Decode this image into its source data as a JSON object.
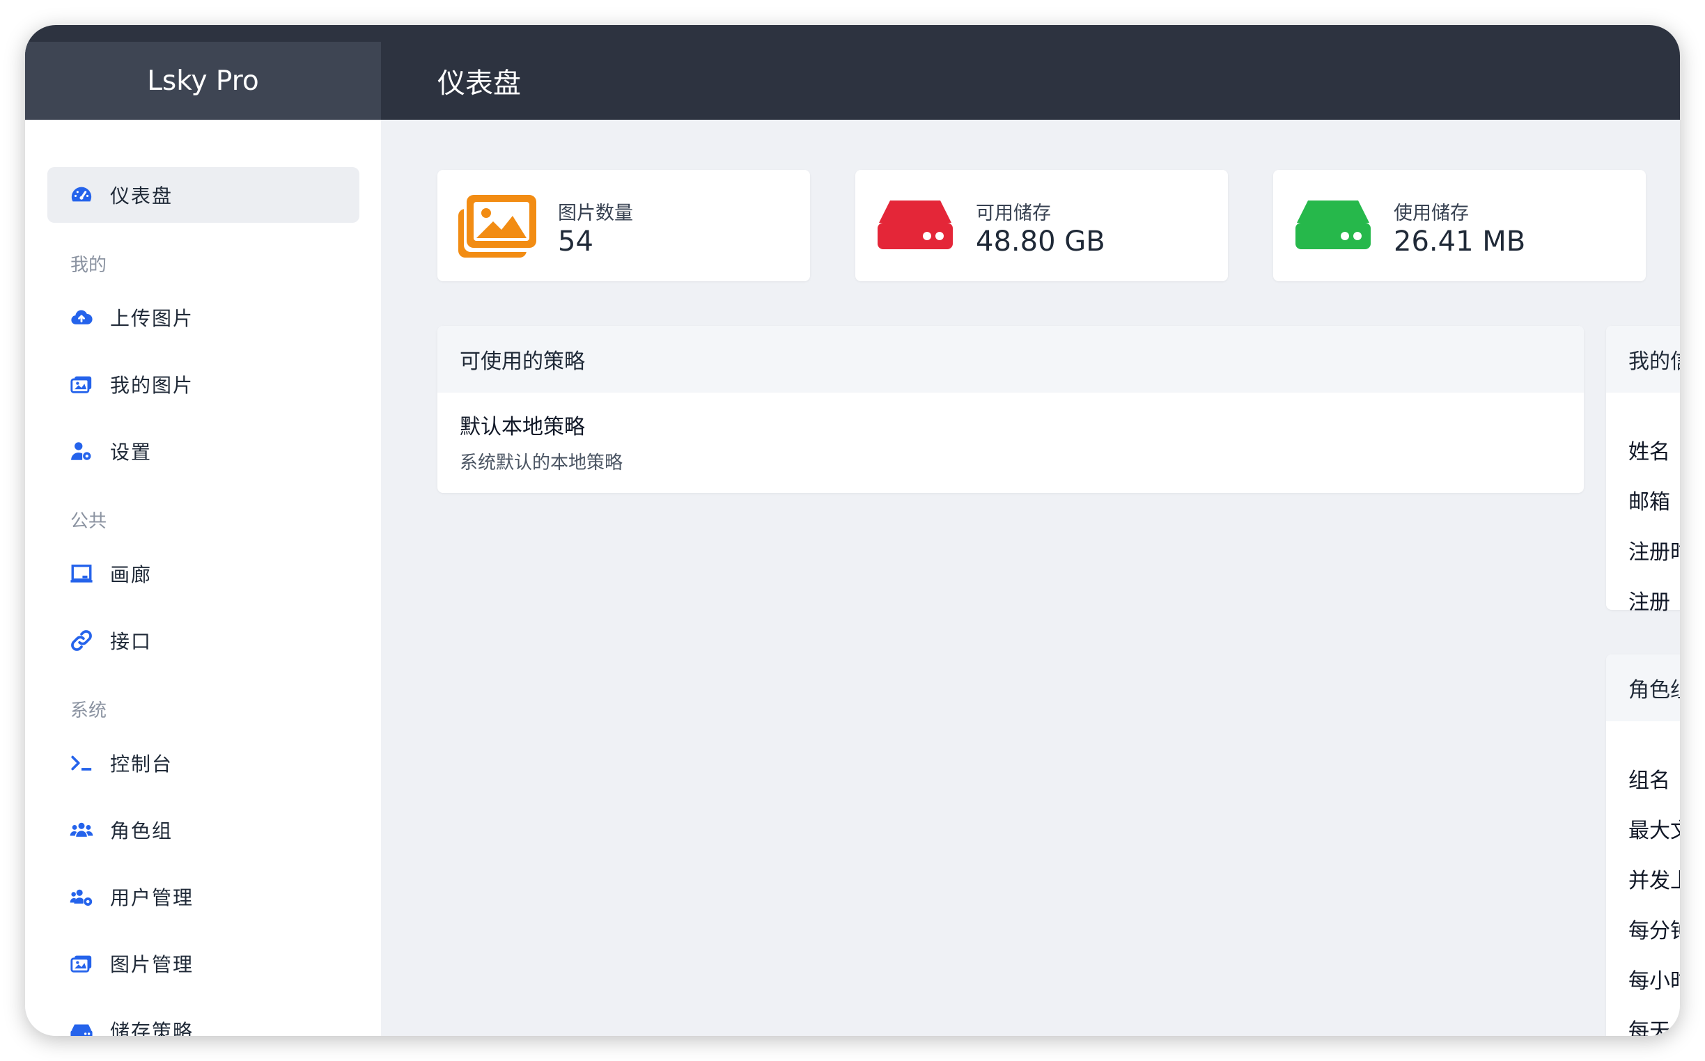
{
  "app": {
    "brand": "Lsky Pro",
    "page_title": "仪表盘"
  },
  "sidebar": {
    "items": [
      {
        "label": "仪表盘",
        "icon": "dashboard-gauge-icon",
        "active": true
      },
      {
        "section": "我的"
      },
      {
        "label": "上传图片",
        "icon": "cloud-upload-icon"
      },
      {
        "label": "我的图片",
        "icon": "images-icon"
      },
      {
        "label": "设置",
        "icon": "user-settings-icon"
      },
      {
        "section": "公共"
      },
      {
        "label": "画廊",
        "icon": "monitor-icon"
      },
      {
        "label": "接口",
        "icon": "link-icon"
      },
      {
        "section": "系统"
      },
      {
        "label": "控制台",
        "icon": "terminal-icon"
      },
      {
        "label": "角色组",
        "icon": "users-group-icon"
      },
      {
        "label": "用户管理",
        "icon": "users-settings-icon"
      },
      {
        "label": "图片管理",
        "icon": "images-manage-icon"
      },
      {
        "label": "储存策略",
        "icon": "storage-drive-icon"
      }
    ]
  },
  "stats": [
    {
      "label": "图片数量",
      "value": "54",
      "icon": "images-stack-icon",
      "color": "#f28c13"
    },
    {
      "label": "可用储存",
      "value": "48.80 GB",
      "icon": "hard-drive-icon",
      "color": "#e42638"
    },
    {
      "label": "使用储存",
      "value": "26.41 MB",
      "icon": "hard-drive-icon",
      "color": "#26b84b"
    }
  ],
  "policies": {
    "header": "可使用的策略",
    "items": [
      {
        "name": "默认本地策略",
        "description": "系统默认的本地策略"
      }
    ]
  },
  "my_info": {
    "header": "我的信",
    "rows": [
      "姓名",
      "邮箱",
      "注册时",
      "注册"
    ]
  },
  "role_group": {
    "header": "角色组",
    "rows": [
      "组名",
      "最大文",
      "并发上",
      "每分钟",
      "每小时",
      "每天上"
    ]
  },
  "colors": {
    "accent": "#2563eb",
    "titlebar": "#2d3340",
    "brand_bg": "#3e4553",
    "content_bg": "#eff1f5"
  }
}
